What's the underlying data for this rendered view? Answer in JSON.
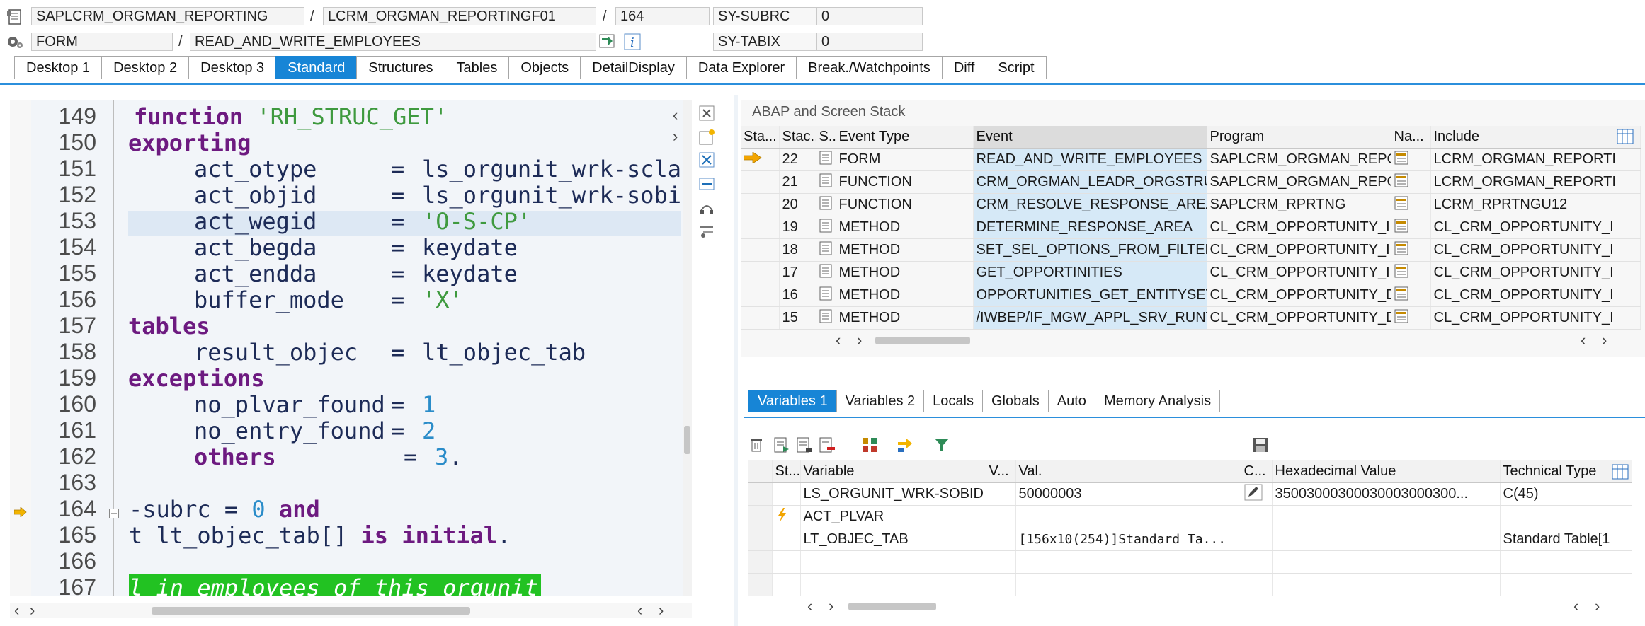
{
  "top": {
    "program": "SAPLCRM_ORGMAN_REPORTING",
    "include": "LCRM_ORGMAN_REPORTINGF01",
    "line": "164",
    "subrc_label": "SY-SUBRC",
    "subrc_value": "0",
    "event_type": "FORM",
    "event_name": "READ_AND_WRITE_EMPLOYEES",
    "tabix_label": "SY-TABIX",
    "tabix_value": "0",
    "sep": "/"
  },
  "tabs": [
    "Desktop 1",
    "Desktop 2",
    "Desktop 3",
    "Standard",
    "Structures",
    "Tables",
    "Objects",
    "DetailDisplay",
    "Data Explorer",
    "Break./Watchpoints",
    "Diff",
    "Script"
  ],
  "editor": {
    "line_numbers": [
      "149",
      "150",
      "151",
      "152",
      "153",
      "154",
      "155",
      "156",
      "157",
      "158",
      "159",
      "160",
      "161",
      "162",
      "163",
      "164",
      "165",
      "166",
      "167"
    ],
    "lines": {
      "l149_kw": "function",
      "l149_str": "'RH_STRUC_GET'",
      "l150_kw": "exporting",
      "l151_a": "act_otype",
      "l151_b": "=",
      "l151_c": "ls_orgunit_wrk-scla",
      "l152_a": "act_objid",
      "l152_b": "=",
      "l152_c": "ls_orgunit_wrk-sobi",
      "l153_a": "act_wegid",
      "l153_b": "=",
      "l153_str": "'O-S-CP'",
      "l154_a": "act_begda",
      "l154_b": "=",
      "l154_c": "keydate",
      "l155_a": "act_endda",
      "l155_b": "=",
      "l155_c": "keydate",
      "l156_a": "buffer_mode",
      "l156_b": "=",
      "l156_str": "'X'",
      "l157_kw": "tables",
      "l158_a": "result_objec",
      "l158_b": "=",
      "l158_c": "lt_objec_tab",
      "l159_kw": "exceptions",
      "l160_a": "no_plvar_found",
      "l160_b": "=",
      "l160_num": "1",
      "l161_a": "no_entry_found",
      "l161_b": "=",
      "l161_num": "2",
      "l162_kw": "others",
      "l162_b": "=",
      "l162_num": "3",
      "l162_dot": ".",
      "l164_a": "-subrc",
      "l164_b": "=",
      "l164_num": "0",
      "l164_kw": "and",
      "l165_a": "t lt_objec_tab[]",
      "l165_kw": "is initial",
      "l165_dot": ".",
      "l167_comment": "l in employees of this orgunit"
    }
  },
  "stack": {
    "title": "ABAP and Screen Stack",
    "columns": [
      "Sta...",
      "Stac...",
      "S..",
      "Event Type",
      "Event",
      "Program",
      "Na...",
      "Include"
    ],
    "rows": [
      {
        "level": "22",
        "type": "FORM",
        "event": "READ_AND_WRITE_EMPLOYEES",
        "program": "SAPLCRM_ORGMAN_REPO...",
        "include": "LCRM_ORGMAN_REPORTI",
        "current": true
      },
      {
        "level": "21",
        "type": "FUNCTION",
        "event": "CRM_ORGMAN_LEADR_ORGSTRUC...",
        "program": "SAPLCRM_ORGMAN_REPO...",
        "include": "LCRM_ORGMAN_REPORTI",
        "current": false
      },
      {
        "level": "20",
        "type": "FUNCTION",
        "event": "CRM_RESOLVE_RESPONSE_AREA",
        "program": "SAPLCRM_RPRTNG",
        "include": "LCRM_RPRTNGU12",
        "current": false
      },
      {
        "level": "19",
        "type": "METHOD",
        "event": "DETERMINE_RESPONSE_AREA",
        "program": "CL_CRM_OPPORTUNITY_I...",
        "include": "CL_CRM_OPPORTUNITY_I",
        "current": false
      },
      {
        "level": "18",
        "type": "METHOD",
        "event": "SET_SEL_OPTIONS_FROM_FILTER...",
        "program": "CL_CRM_OPPORTUNITY_I...",
        "include": "CL_CRM_OPPORTUNITY_I",
        "current": false
      },
      {
        "level": "17",
        "type": "METHOD",
        "event": "GET_OPPORTINITIES",
        "program": "CL_CRM_OPPORTUNITY_I...",
        "include": "CL_CRM_OPPORTUNITY_I",
        "current": false
      },
      {
        "level": "16",
        "type": "METHOD",
        "event": "OPPORTUNITIES_GET_ENTITYSET",
        "program": "CL_CRM_OPPORTUNITY_D...",
        "include": "CL_CRM_OPPORTUNITY_I",
        "current": false
      },
      {
        "level": "15",
        "type": "METHOD",
        "event": "/IWBEP/IF_MGW_APPL_SRV_RUNT...",
        "program": "CL_CRM_OPPORTUNITY_D...",
        "include": "CL_CRM_OPPORTUNITY_I",
        "current": false
      }
    ]
  },
  "vars": {
    "tabs": [
      "Variables 1",
      "Variables 2",
      "Locals",
      "Globals",
      "Auto",
      "Memory Analysis"
    ],
    "columns": [
      "St...",
      "Variable",
      "V...",
      "Val.",
      "C...",
      "Hexadecimal Value",
      "Technical Type"
    ],
    "rows": [
      {
        "name": "LS_ORGUNIT_WRK-SOBID",
        "value": "50000003",
        "hex": "35003000300030003000300...",
        "type": "C(45)"
      },
      {
        "name": "ACT_PLVAR",
        "value": "",
        "hex": "",
        "type": ""
      },
      {
        "name": "LT_OBJEC_TAB",
        "value": "[156x10(254)]Standard Ta...",
        "hex": "",
        "type": "Standard Table[1"
      },
      {
        "name": "",
        "value": "",
        "hex": "",
        "type": ""
      },
      {
        "name": "",
        "value": "",
        "hex": "",
        "type": ""
      }
    ]
  },
  "colors": {
    "accent": "#1785d6",
    "keyword": "#6d1a80",
    "string": "#3f9a3f",
    "number": "#2a8cc9",
    "comment_bg": "#22c222",
    "event_highlight": "#d6e9f7"
  }
}
